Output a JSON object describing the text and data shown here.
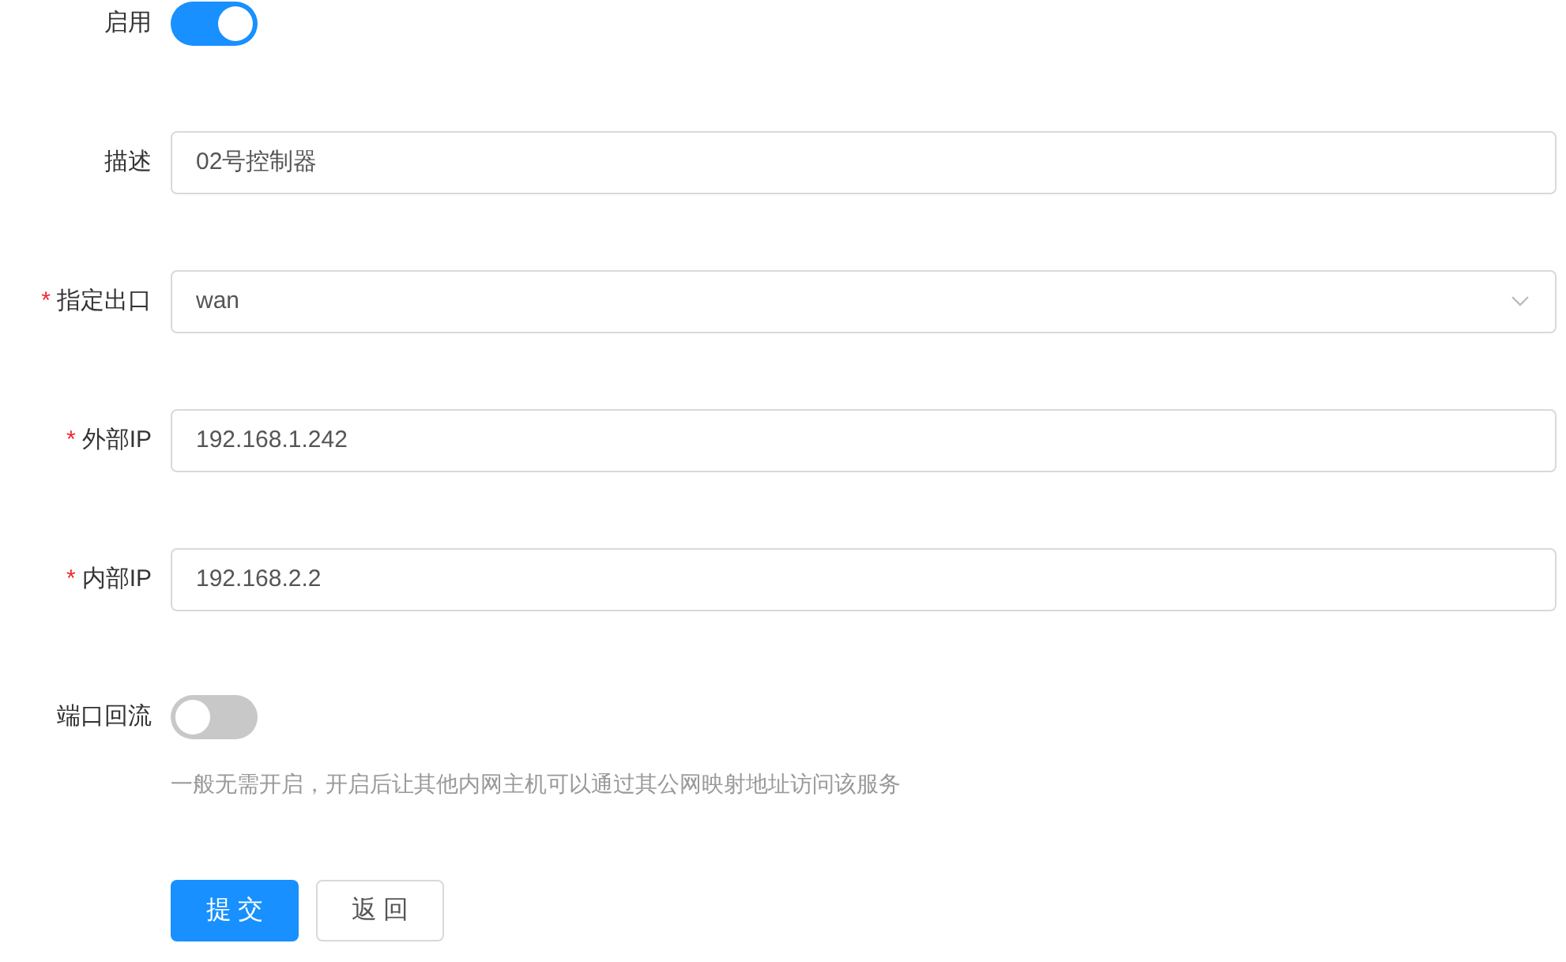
{
  "fields": [
    {
      "kind": "switch",
      "label": "启用",
      "on": true
    },
    {
      "kind": "text",
      "label": "描述",
      "value": "02号控制器"
    },
    {
      "kind": "select",
      "required_mark": "*",
      "label": "指定出口",
      "value": "wan"
    },
    {
      "kind": "text",
      "required_mark": "*",
      "label": "外部IP",
      "value": "192.168.1.242"
    },
    {
      "kind": "text",
      "required_mark": "*",
      "label": "内部IP",
      "value": "192.168.2.2"
    },
    {
      "kind": "switch",
      "label": "端口回流",
      "on": false,
      "hint": "一般无需开启，开启后让其他内网主机可以通过其公网映射地址访问该服务"
    }
  ],
  "buttons": [
    {
      "kind": "primary",
      "label": "提 交"
    },
    {
      "kind": "default",
      "label": "返 回"
    }
  ]
}
